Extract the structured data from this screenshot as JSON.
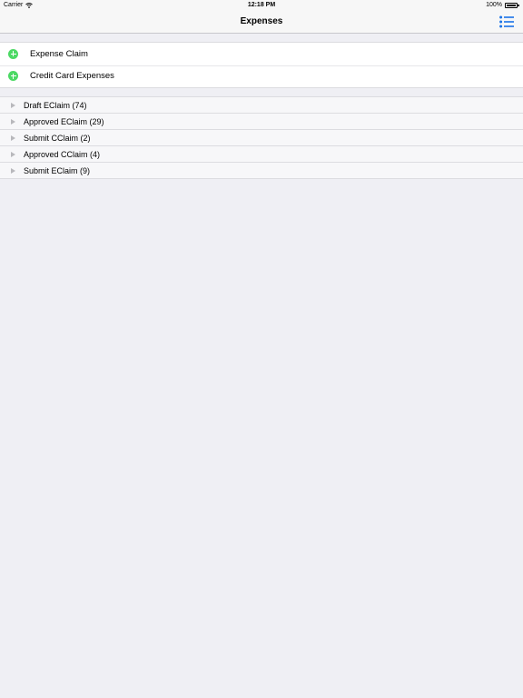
{
  "status_bar": {
    "carrier": "Carrier",
    "time": "12:18 PM",
    "battery": "100%"
  },
  "nav": {
    "title": "Expenses",
    "accent_color": "#1a73e8"
  },
  "actions": [
    {
      "label": "Expense Claim",
      "icon": "add-circle-icon"
    },
    {
      "label": "Credit Card Expenses",
      "icon": "add-circle-icon"
    }
  ],
  "claims": [
    {
      "label": "Draft EClaim (74)"
    },
    {
      "label": "Approved EClaim (29)"
    },
    {
      "label": "Submit CClaim (2)"
    },
    {
      "label": "Approved CClaim (4)"
    },
    {
      "label": "Submit EClaim (9)"
    }
  ]
}
